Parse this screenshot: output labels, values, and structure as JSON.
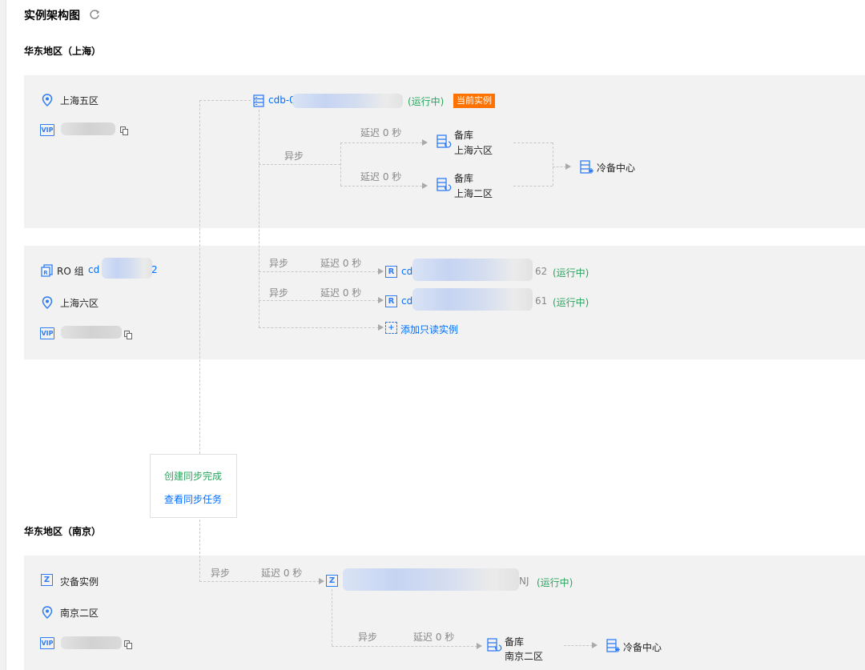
{
  "page": {
    "title": "实例架构图",
    "region_shanghai": "华东地区（上海）",
    "region_nanjing": "华东地区（南京）"
  },
  "primary": {
    "zone": "上海五区",
    "instance_prefix": "cdb-0",
    "status": "(运行中)",
    "badge": "当前实例",
    "standby1_label": "备库",
    "standby1_zone": "上海六区",
    "standby2_label": "备库",
    "standby2_zone": "上海二区",
    "async_label": "异步",
    "delay1": "延迟 0 秒",
    "delay2": "延迟 0 秒",
    "cold_backup": "冷备中心",
    "vip_icon": "VIP"
  },
  "ro_group": {
    "label": "RO 组",
    "id_prefix": "cd",
    "id_suffix": "2",
    "zone": "上海六区",
    "rows": [
      {
        "async": "异步",
        "delay": "延迟 0 秒",
        "prefix": "cd",
        "suffix": "62",
        "status": "(运行中)"
      },
      {
        "async": "异步",
        "delay": "延迟 0 秒",
        "prefix": "cd",
        "suffix": "61",
        "status": "(运行中)"
      }
    ],
    "add_readonly": "添加只读实例"
  },
  "popup": {
    "sync_done": "创建同步完成",
    "view_task": "查看同步任务"
  },
  "dr": {
    "label": "灾备实例",
    "zone": "南京二区",
    "async": "异步",
    "delay": "延迟 0 秒",
    "suffix": "NJ",
    "status": "(运行中)",
    "async2": "异步",
    "delay2": "延迟 0 秒",
    "standby_label": "备库",
    "standby_zone": "南京二区",
    "cold_backup": "冷备中心"
  },
  "icons": {
    "refresh": "refresh-icon",
    "location": "location-pin-icon",
    "copy": "copy-icon",
    "db": "database-icon",
    "standby": "standby-db-icon",
    "cold": "cold-backup-icon",
    "readonly": "readonly-r-icon",
    "add": "plus-icon",
    "dr": "dr-z-icon",
    "ro_group": "ro-group-icon"
  },
  "colors": {
    "link": "#006eff",
    "running": "#29a55d",
    "badge": "#ff7200",
    "panel": "#f2f2f2"
  }
}
